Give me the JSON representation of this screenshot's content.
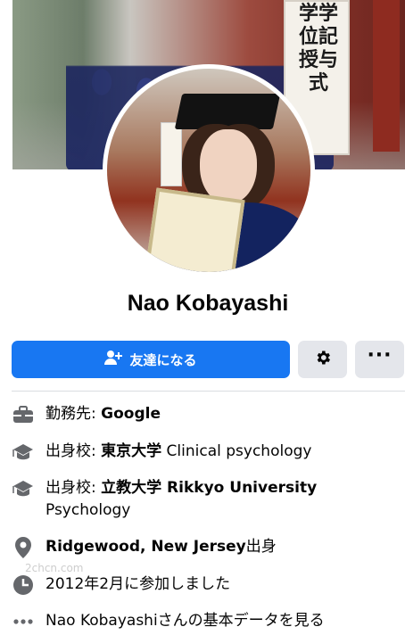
{
  "cover": {
    "sign_text": "学学位記授与式"
  },
  "profile": {
    "name": "Nao Kobayashi"
  },
  "actions": {
    "add_friend_label": "友達になる",
    "settings_icon": "gear-icon",
    "more_label": "···",
    "accent_color": "#1877f2"
  },
  "intro": {
    "work_prefix": "勤務先: ",
    "work_value": "Google",
    "edu1_prefix": "出身校: ",
    "edu1_school": "東京大学",
    "edu1_field": " Clinical psychology",
    "edu2_prefix": "出身校: ",
    "edu2_school": "立教大学 Rikkyo University",
    "edu2_field": " Psychology",
    "hometown_value": "Ridgewood, New Jersey",
    "hometown_suffix": "出身",
    "joined": "2012年2月に参加しました",
    "about_link": "Nao Kobayashiさんの基本データを見る"
  },
  "watermark": {
    "text": "2chcn.com"
  }
}
